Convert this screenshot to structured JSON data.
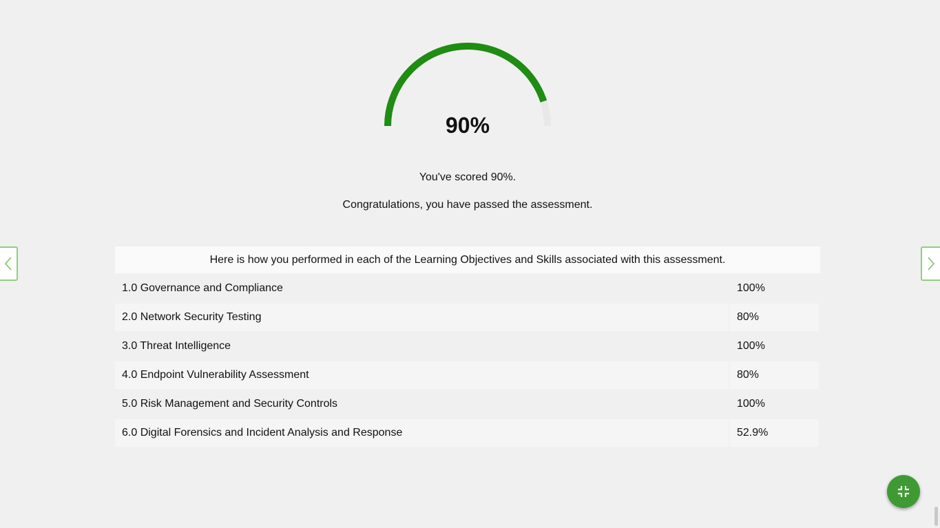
{
  "score": {
    "value": 90,
    "gauge_label": "90%",
    "progress_color": "#1f8c12",
    "track_color": "#e8e8e8"
  },
  "messages": {
    "score_text": "You've scored 90%.",
    "result_text": "Congratulations, you have passed the assessment."
  },
  "results": {
    "header": "Here is how you performed in each of the Learning Objectives and Skills associated with this assessment.",
    "rows": [
      {
        "name": "1.0 Governance and Compliance",
        "score": "100%"
      },
      {
        "name": "2.0 Network Security Testing",
        "score": "80%"
      },
      {
        "name": "3.0 Threat Intelligence",
        "score": "100%"
      },
      {
        "name": "4.0 Endpoint Vulnerability Assessment",
        "score": "80%"
      },
      {
        "name": "5.0 Risk Management and Security Controls",
        "score": "100%"
      },
      {
        "name": "6.0 Digital Forensics and Incident Analysis and Response",
        "score": "52.9%"
      }
    ]
  },
  "navigation": {
    "prev_icon": "chevron-left-icon",
    "next_icon": "chevron-right-icon",
    "accent_color": "#8fcf7f"
  },
  "fab": {
    "icon": "exit-fullscreen-icon",
    "color": "#3f9a34"
  }
}
